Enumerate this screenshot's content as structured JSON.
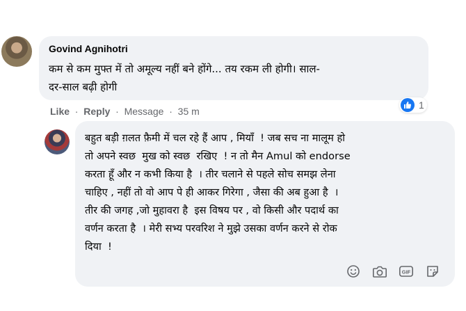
{
  "comments": [
    {
      "author": "Govind Agnihotri",
      "text": "कम से कम मुफ्त में तो अमूल्य नहीं बने होंगे... तय रकम ली होगी। साल-\nदर-साल बढ़ी होगी",
      "actions": {
        "like": "Like",
        "reply": "Reply",
        "message": "Message",
        "time": "35 m"
      },
      "reaction": {
        "icon": "like-icon",
        "count": "1",
        "color": "#1877f2"
      }
    }
  ],
  "reply_draft": {
    "text": "बहुत बड़ी ग़लत फ़ैमी में चल रहे हैं आप , मियाँ  ! जब सच ना मालूम हो\nतो अपने स्वछ  मुख को स्वछ  रखिए  ! न तो मैन Amul को endorse\nकरता हूँ और न कभी किया है  । तीर चलाने से पहले सोच समझ लेना\nचाहिए , नहीं तो वो आप पे ही आकर गिरेगा , जैसा की अब हुआ है  ।\nतीर की जगह ,जो मुहावरा है  इस विषय पर , वो किसी और पदार्थ का\nवर्णन करता है  । मेरी सभ्य परवरिश ने मुझे उसका वर्णन करने से रोक\nदिया  !",
    "toolbar_icons": [
      "emoji-icon",
      "camera-icon",
      "gif-icon",
      "sticker-icon"
    ],
    "gif_label": "GIF"
  }
}
